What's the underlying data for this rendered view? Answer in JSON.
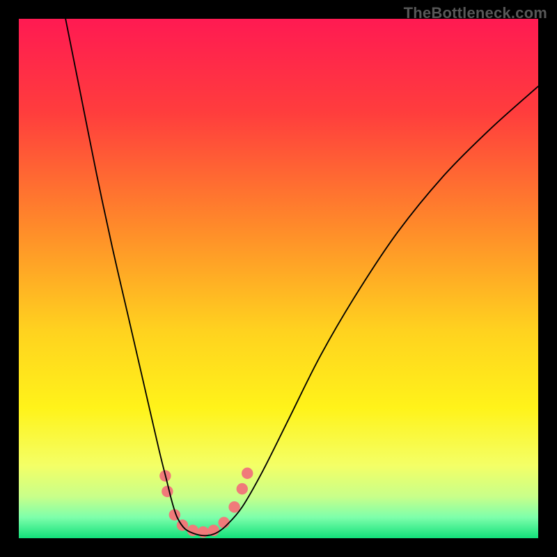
{
  "watermark": "TheBottleneck.com",
  "chart_data": {
    "type": "line",
    "title": "",
    "xlabel": "",
    "ylabel": "",
    "xlim": [
      0,
      1000
    ],
    "ylim": [
      0,
      1000
    ],
    "series": [
      {
        "name": "curve",
        "x": [
          90,
          120,
          150,
          180,
          210,
          240,
          270,
          285,
          295,
          305,
          320,
          340,
          360,
          380,
          400,
          430,
          470,
          520,
          580,
          650,
          730,
          820,
          910,
          1000
        ],
        "y_interp": [
          1000,
          850,
          700,
          560,
          430,
          300,
          170,
          110,
          70,
          40,
          18,
          8,
          5,
          10,
          25,
          60,
          130,
          230,
          350,
          470,
          590,
          700,
          790,
          870
        ]
      },
      {
        "name": "markers",
        "points": [
          {
            "x": 282,
            "y": 120
          },
          {
            "x": 286,
            "y": 90
          },
          {
            "x": 300,
            "y": 45
          },
          {
            "x": 315,
            "y": 25
          },
          {
            "x": 335,
            "y": 15
          },
          {
            "x": 355,
            "y": 12
          },
          {
            "x": 375,
            "y": 15
          },
          {
            "x": 395,
            "y": 30
          },
          {
            "x": 415,
            "y": 60
          },
          {
            "x": 430,
            "y": 95
          },
          {
            "x": 440,
            "y": 125
          }
        ]
      }
    ],
    "gradient_stops": [
      {
        "offset": 0.0,
        "color": "#ff1a52"
      },
      {
        "offset": 0.18,
        "color": "#ff3d3d"
      },
      {
        "offset": 0.4,
        "color": "#ff8a2a"
      },
      {
        "offset": 0.6,
        "color": "#ffd21f"
      },
      {
        "offset": 0.75,
        "color": "#fff31a"
      },
      {
        "offset": 0.86,
        "color": "#f4ff66"
      },
      {
        "offset": 0.92,
        "color": "#c8ff8a"
      },
      {
        "offset": 0.96,
        "color": "#7dffab"
      },
      {
        "offset": 1.0,
        "color": "#12e07a"
      }
    ],
    "marker_color": "#f07a7a",
    "marker_radius": 11,
    "curve_color": "#000000",
    "curve_width": 2.5
  }
}
